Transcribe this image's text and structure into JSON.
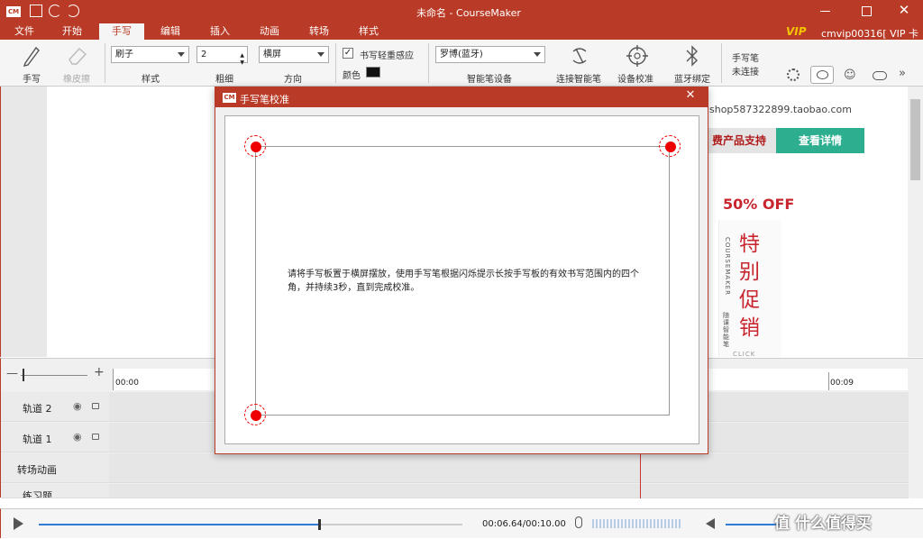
{
  "window": {
    "title": "未命名 - CourseMaker",
    "logo": "CM",
    "vip_badge": "VIP",
    "user": "cmvip00316[ VIP 卡 ]"
  },
  "menu": {
    "items": [
      "文件",
      "开始",
      "手写",
      "编辑",
      "插入",
      "动画",
      "转场",
      "样式"
    ],
    "active": "手写"
  },
  "ribbon": {
    "pen_label": "手写",
    "eraser_label": "橡皮擦",
    "style_value": "刷子",
    "style_label": "样式",
    "thickness_value": "2",
    "thickness_label": "粗细",
    "direction_value": "横屏",
    "direction_label": "方向",
    "pressure_label": "书写轻重感应",
    "pressure_checked": true,
    "color_label": "颜色",
    "color_value": "#111111",
    "device_value": "罗博(蓝牙)",
    "device_label": "智能笔设备",
    "connect_label": "连接智能笔",
    "calibrate_label": "设备校准",
    "bluetooth_label": "蓝牙绑定",
    "pen_status_line1": "手写笔",
    "pen_status_line2": "未连接"
  },
  "canvas": {
    "shop_url": "shop587322899.taobao.com",
    "banner_left": "费产品支持",
    "banner_right": "查看详情",
    "sale_badge": "50% OFF",
    "promo_text": "特别促销",
    "brand_vertical": "COURSEMAKER",
    "brand_sub": "随课智能笔",
    "click_text": "CLICK"
  },
  "timeline": {
    "time_start": "00:00",
    "time_end": "00:09",
    "tracks": [
      "轨道 2",
      "轨道 1",
      "转场动画",
      "练习题"
    ]
  },
  "playback": {
    "time": "00:06.64/00:10.00",
    "progress": 0.66
  },
  "dialog": {
    "title": "手写笔校准",
    "logo": "CM",
    "instruction": "请将手写板置于横屏摆放，使用手写笔根据闪烁提示长按手写板的有效书写范围内的四个角，并持续3秒，直到完成校准。"
  },
  "watermark": "值 什么值得买",
  "colors": {
    "accent": "#b93a26",
    "target": "#e60000",
    "banner_green": "#2cae8f"
  }
}
